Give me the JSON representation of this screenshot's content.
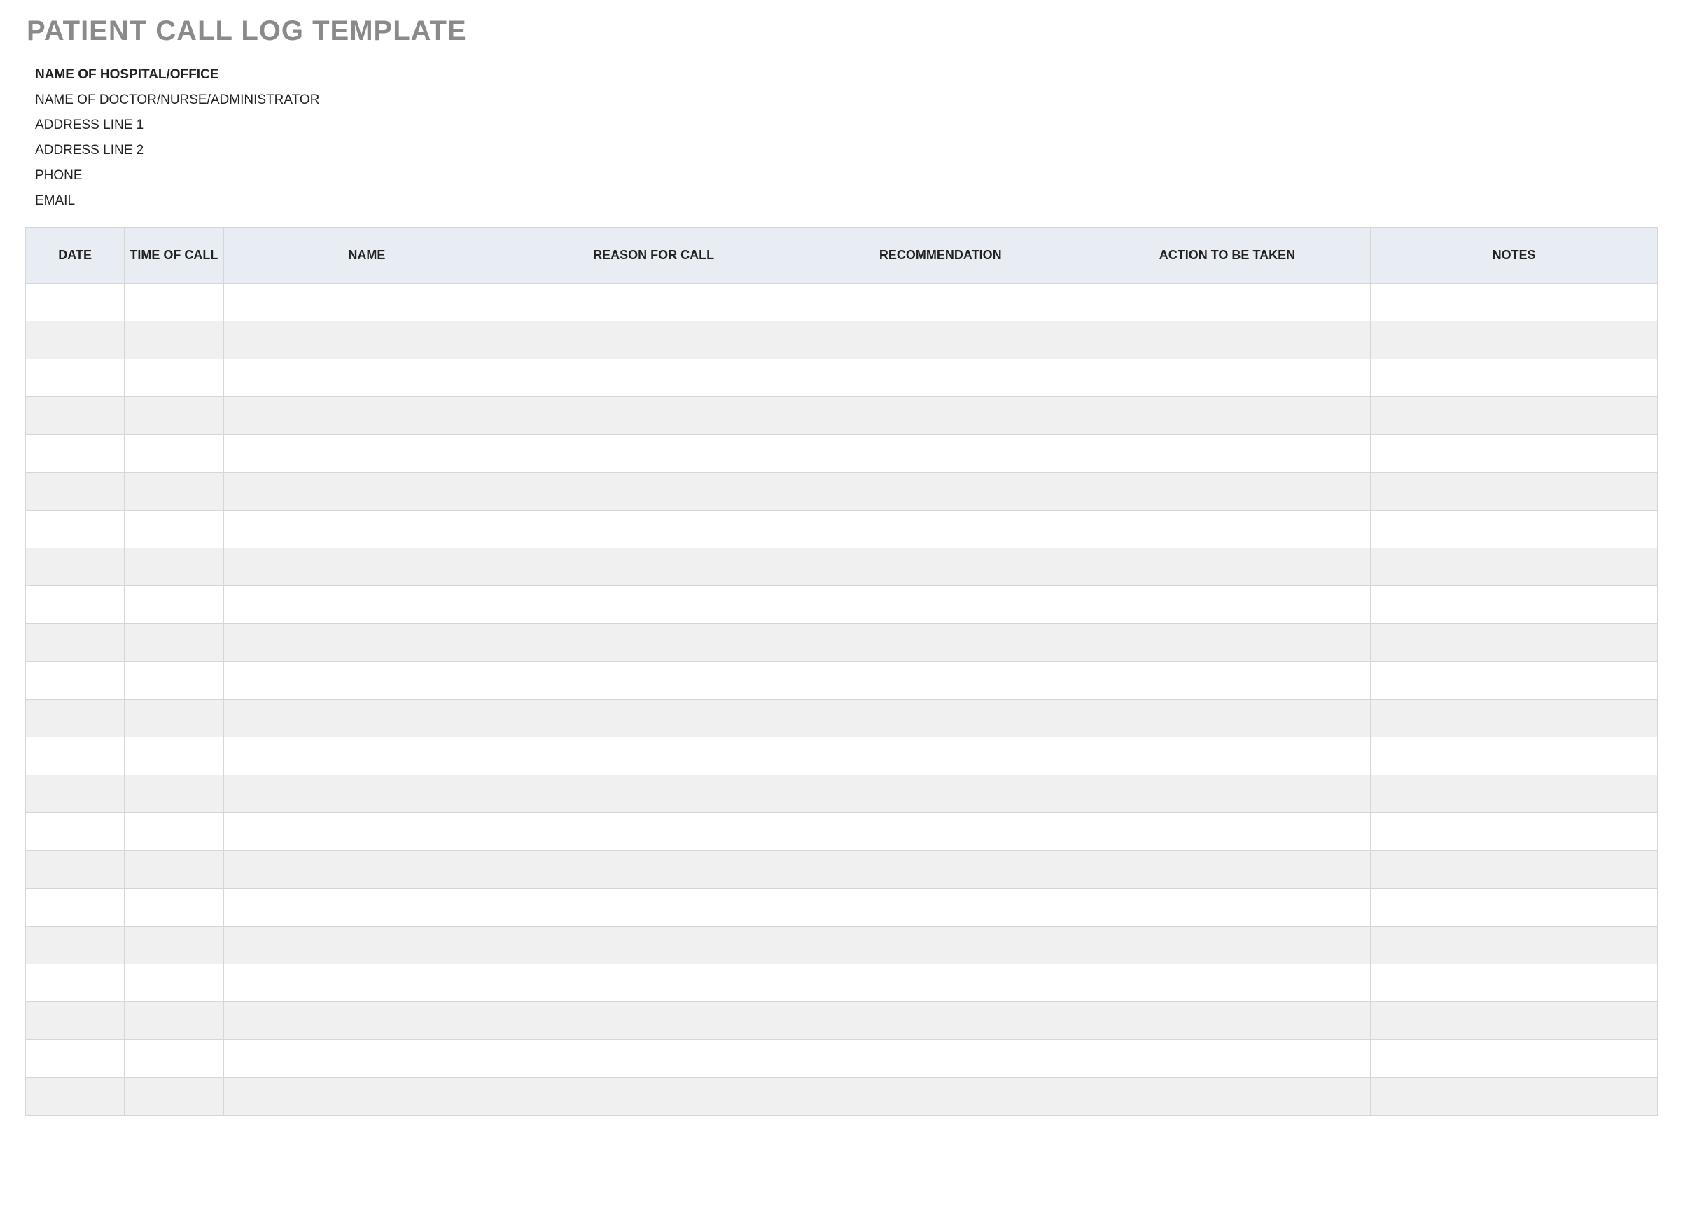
{
  "title": "PATIENT CALL LOG TEMPLATE",
  "info": {
    "hospital": "NAME OF HOSPITAL/OFFICE",
    "doctor": "NAME OF DOCTOR/NURSE/ADMINISTRATOR",
    "address1": "ADDRESS LINE 1",
    "address2": "ADDRESS LINE 2",
    "phone": "PHONE",
    "email": "EMAIL"
  },
  "columns": {
    "date": "DATE",
    "time": "TIME OF CALL",
    "name": "NAME",
    "reason": "REASON FOR CALL",
    "recommendation": "RECOMMENDATION",
    "action": "ACTION TO BE TAKEN",
    "notes": "NOTES"
  },
  "rows": [
    {
      "date": "",
      "time": "",
      "name": "",
      "reason": "",
      "recommendation": "",
      "action": "",
      "notes": ""
    },
    {
      "date": "",
      "time": "",
      "name": "",
      "reason": "",
      "recommendation": "",
      "action": "",
      "notes": ""
    },
    {
      "date": "",
      "time": "",
      "name": "",
      "reason": "",
      "recommendation": "",
      "action": "",
      "notes": ""
    },
    {
      "date": "",
      "time": "",
      "name": "",
      "reason": "",
      "recommendation": "",
      "action": "",
      "notes": ""
    },
    {
      "date": "",
      "time": "",
      "name": "",
      "reason": "",
      "recommendation": "",
      "action": "",
      "notes": ""
    },
    {
      "date": "",
      "time": "",
      "name": "",
      "reason": "",
      "recommendation": "",
      "action": "",
      "notes": ""
    },
    {
      "date": "",
      "time": "",
      "name": "",
      "reason": "",
      "recommendation": "",
      "action": "",
      "notes": ""
    },
    {
      "date": "",
      "time": "",
      "name": "",
      "reason": "",
      "recommendation": "",
      "action": "",
      "notes": ""
    },
    {
      "date": "",
      "time": "",
      "name": "",
      "reason": "",
      "recommendation": "",
      "action": "",
      "notes": ""
    },
    {
      "date": "",
      "time": "",
      "name": "",
      "reason": "",
      "recommendation": "",
      "action": "",
      "notes": ""
    },
    {
      "date": "",
      "time": "",
      "name": "",
      "reason": "",
      "recommendation": "",
      "action": "",
      "notes": ""
    },
    {
      "date": "",
      "time": "",
      "name": "",
      "reason": "",
      "recommendation": "",
      "action": "",
      "notes": ""
    },
    {
      "date": "",
      "time": "",
      "name": "",
      "reason": "",
      "recommendation": "",
      "action": "",
      "notes": ""
    },
    {
      "date": "",
      "time": "",
      "name": "",
      "reason": "",
      "recommendation": "",
      "action": "",
      "notes": ""
    },
    {
      "date": "",
      "time": "",
      "name": "",
      "reason": "",
      "recommendation": "",
      "action": "",
      "notes": ""
    },
    {
      "date": "",
      "time": "",
      "name": "",
      "reason": "",
      "recommendation": "",
      "action": "",
      "notes": ""
    },
    {
      "date": "",
      "time": "",
      "name": "",
      "reason": "",
      "recommendation": "",
      "action": "",
      "notes": ""
    },
    {
      "date": "",
      "time": "",
      "name": "",
      "reason": "",
      "recommendation": "",
      "action": "",
      "notes": ""
    },
    {
      "date": "",
      "time": "",
      "name": "",
      "reason": "",
      "recommendation": "",
      "action": "",
      "notes": ""
    },
    {
      "date": "",
      "time": "",
      "name": "",
      "reason": "",
      "recommendation": "",
      "action": "",
      "notes": ""
    },
    {
      "date": "",
      "time": "",
      "name": "",
      "reason": "",
      "recommendation": "",
      "action": "",
      "notes": ""
    },
    {
      "date": "",
      "time": "",
      "name": "",
      "reason": "",
      "recommendation": "",
      "action": "",
      "notes": ""
    }
  ]
}
